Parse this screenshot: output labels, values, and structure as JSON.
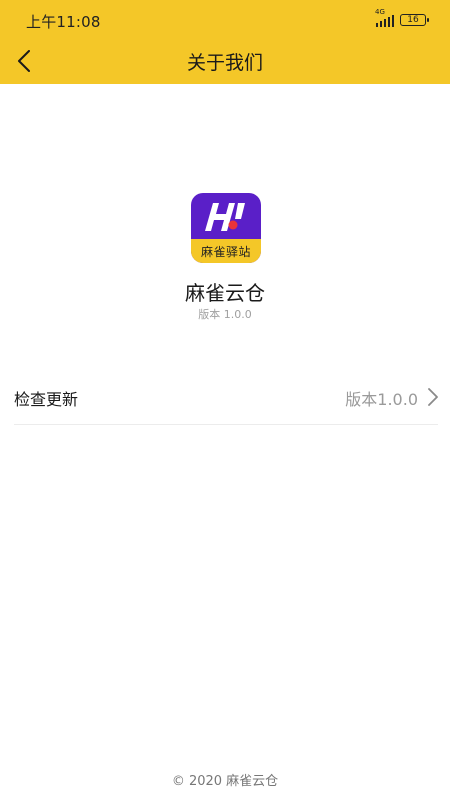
{
  "status_bar": {
    "time": "上午11:08",
    "network": "4G",
    "battery": "16"
  },
  "nav": {
    "title": "关于我们",
    "back_icon": "chevron-left-icon"
  },
  "app": {
    "icon_band_text": "麻雀驿站",
    "icon_colors": {
      "primary": "#5a1fc8",
      "band": "#f4c728",
      "dot": "#e8333b"
    },
    "name": "麻雀云仓",
    "version": "版本 1.0.0"
  },
  "settings": {
    "check_update_label": "检查更新",
    "check_update_value": "版本1.0.0"
  },
  "footer": {
    "copyright": "© 2020 麻雀云仓"
  },
  "colors": {
    "accent": "#f4c728",
    "text": "#1a1a1a",
    "muted": "#9a9a9a"
  }
}
